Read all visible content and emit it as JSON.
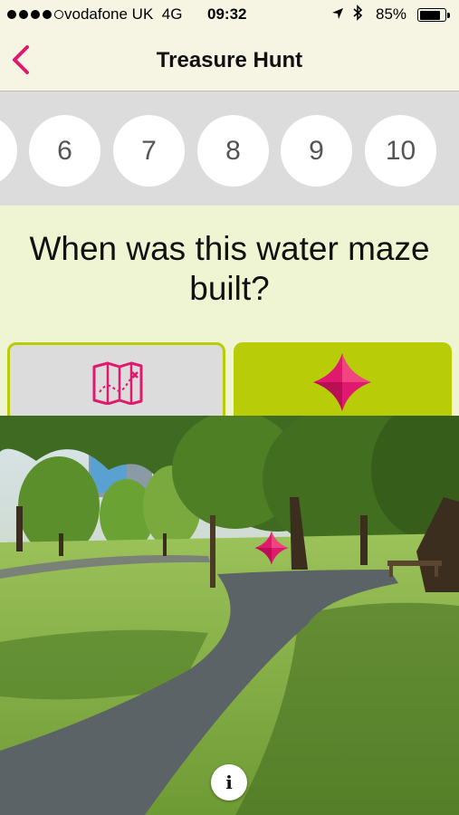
{
  "status_bar": {
    "carrier": "vodafone UK",
    "network": "4G",
    "time": "09:32",
    "battery_percent": "85%",
    "battery_level": 0.85,
    "signal_bars": 4,
    "icons": [
      "signal-dots-icon",
      "location-arrow-icon",
      "bluetooth-icon",
      "battery-icon"
    ]
  },
  "nav": {
    "title": "Treasure Hunt",
    "back_icon": "chevron-left-icon"
  },
  "question_numbers": [
    "6",
    "7",
    "8",
    "9",
    "10"
  ],
  "question": {
    "text": "When was this water maze built?"
  },
  "tabs": {
    "map_icon": "map-icon",
    "ar_icon": "diamond-marker-icon"
  },
  "camera": {
    "marker_icon": "diamond-marker-icon",
    "info_label": "i"
  },
  "colors": {
    "accent": "#e0196f",
    "lime": "#b8cc08",
    "light_lime": "#eff5d2",
    "header_bg": "#f6f5e4"
  }
}
